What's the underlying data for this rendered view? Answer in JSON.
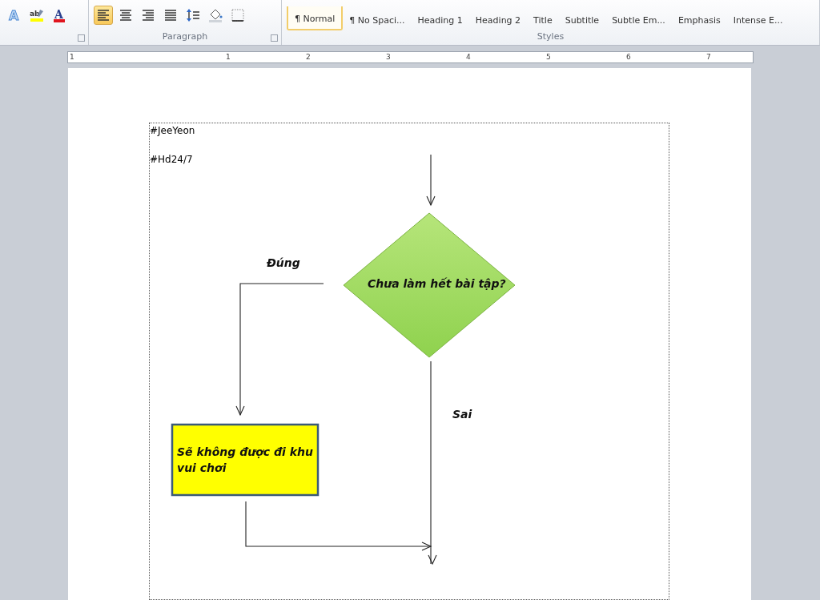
{
  "ribbon": {
    "font_tools": [
      {
        "kind": "text-effects",
        "glyph": "A"
      },
      {
        "kind": "highlight",
        "glyph": "ab"
      },
      {
        "kind": "font-color",
        "glyph": "A"
      }
    ],
    "paragraph_tools": [
      {
        "kind": "align-left",
        "selected": true
      },
      {
        "kind": "align-center",
        "selected": false
      },
      {
        "kind": "align-right",
        "selected": false
      },
      {
        "kind": "justify",
        "selected": false
      },
      {
        "kind": "line-spacing"
      },
      {
        "kind": "shading"
      },
      {
        "kind": "borders"
      }
    ],
    "paragraph_label": "Paragraph",
    "styles": [
      {
        "label": "¶ Normal",
        "selected": true
      },
      {
        "label": "¶ No Spaci...",
        "selected": false
      },
      {
        "label": "Heading 1",
        "selected": false
      },
      {
        "label": "Heading 2",
        "selected": false
      },
      {
        "label": "Title",
        "selected": false
      },
      {
        "label": "Subtitle",
        "selected": false
      },
      {
        "label": "Subtle Em...",
        "selected": false
      },
      {
        "label": "Emphasis",
        "selected": false
      },
      {
        "label": "Intense E...",
        "selected": false
      }
    ],
    "styles_label": "Styles"
  },
  "ruler": {
    "numbers": [
      "1",
      "1",
      "2",
      "3",
      "4",
      "5",
      "6",
      "7"
    ]
  },
  "document": {
    "lines": [
      "#JeeYeon",
      "#Hd24/7"
    ],
    "flowchart": {
      "decision": "Chưa làm hết bài tập?",
      "process": "Sẽ không được đi khu vui chơi",
      "yes_label": "Đúng",
      "no_label": "Sai"
    }
  }
}
